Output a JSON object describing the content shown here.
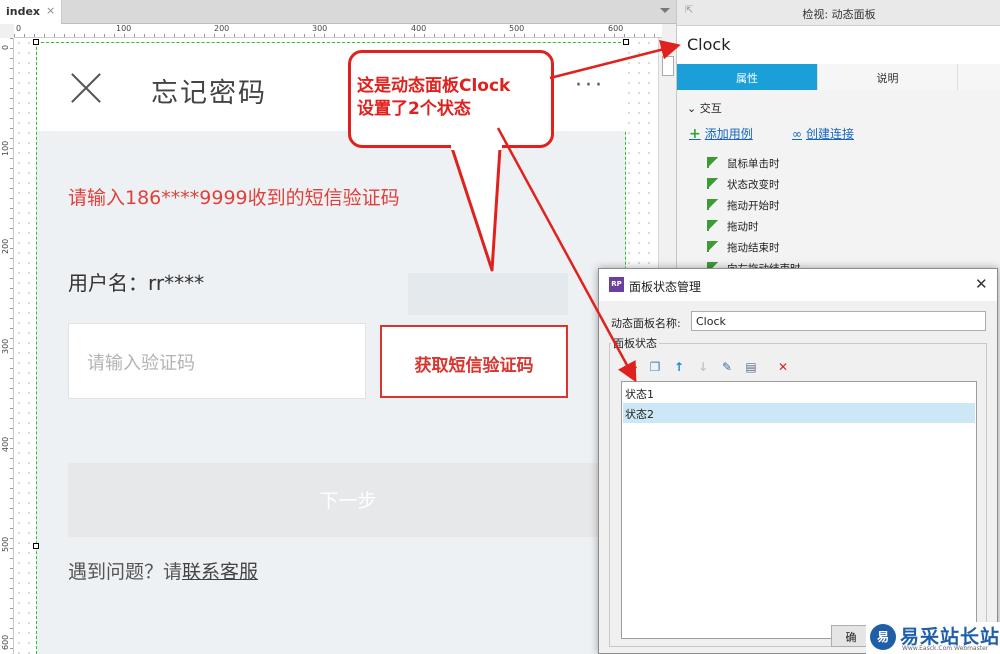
{
  "tabbar": {
    "tab_label": "index",
    "close_glyph": "×"
  },
  "rulers": {
    "h_labels": [
      "0",
      "100",
      "200",
      "300",
      "400",
      "500",
      "600"
    ],
    "v_labels": [
      "0",
      "100",
      "200",
      "300",
      "400",
      "500",
      "600"
    ]
  },
  "phone": {
    "close_icon": "close-icon",
    "title": "忘记密码",
    "more_glyph": "···",
    "hint": "请输入186****9999收到的短信验证码",
    "username": "用户名：rr****",
    "code_placeholder": "请输入验证码",
    "get_code_label": "获取短信验证码",
    "next_label": "下一步",
    "help_prefix": "遇到问题？请",
    "help_link": "联系客服"
  },
  "inspector": {
    "header": "检视: 动态面板",
    "name": "Clock",
    "tabs": [
      "属性",
      "说明"
    ],
    "section": "交互",
    "add_case": "添加用例",
    "create_link": "创建连接",
    "events": [
      "鼠标单击时",
      "状态改变时",
      "拖动开始时",
      "拖动时",
      "拖动结束时",
      "向左拖动结束时"
    ]
  },
  "dialog": {
    "title": "面板状态管理",
    "logo_text": "RP",
    "close_glyph": "✕",
    "name_label": "动态面板名称:",
    "name_value": "Clock",
    "group_title": "面板状态",
    "states": [
      "状态1",
      "状态2"
    ],
    "selected_state_index": 1,
    "button_partial": "确"
  },
  "callout": {
    "line1": "这是动态面板Clock",
    "line2": "设置了2个状态"
  },
  "watermark": {
    "logo": "易",
    "text": "易采站长站",
    "sub": "Www.Easck.Com Webmaster"
  },
  "colors": {
    "accent_blue": "#1a9fd8",
    "callout_red": "#e1211d",
    "hint_red": "#e0403b",
    "selected_row": "#cce8f6"
  }
}
